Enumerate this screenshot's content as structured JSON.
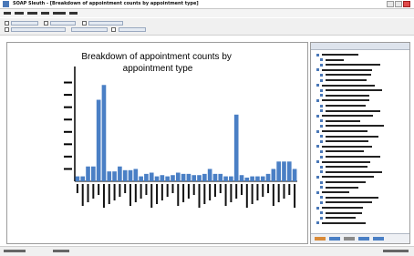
{
  "window": {
    "title": "SOAP Sleuth - [Breakdown of appointment counts by appointment type]"
  },
  "chart_data": {
    "type": "bar",
    "title": "Breakdown of appointment counts by appointment type",
    "xlabel": "",
    "ylabel": "",
    "ylim": [
      0,
      450
    ],
    "bar_color": "#4a7fc5",
    "values": [
      20,
      20,
      60,
      60,
      330,
      390,
      40,
      40,
      60,
      45,
      45,
      50,
      20,
      30,
      35,
      20,
      25,
      20,
      25,
      35,
      30,
      30,
      25,
      25,
      30,
      50,
      30,
      30,
      20,
      20,
      270,
      25,
      15,
      20,
      20,
      20,
      30,
      50,
      80,
      80,
      80,
      50
    ]
  }
}
